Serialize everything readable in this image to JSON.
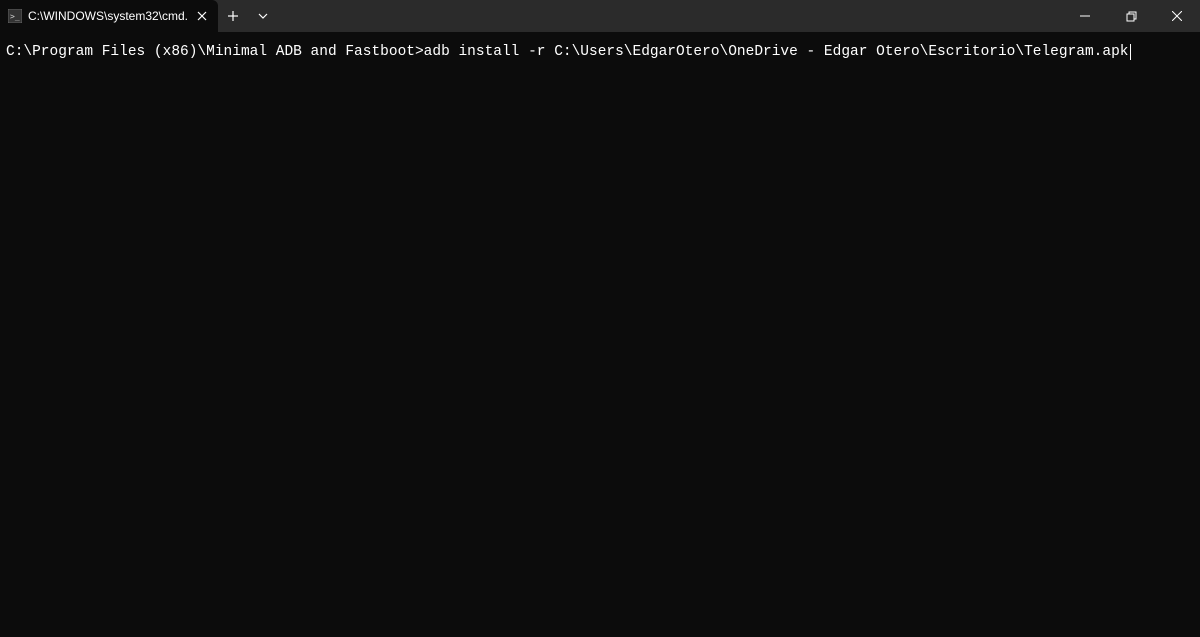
{
  "titlebar": {
    "tab_title": "C:\\WINDOWS\\system32\\cmd.",
    "new_tab_symbol": "+",
    "close_symbol": "✕"
  },
  "terminal": {
    "prompt": "C:\\Program Files (x86)\\Minimal ADB and Fastboot>",
    "command": "adb install -r C:\\Users\\EdgarOtero\\OneDrive - Edgar Otero\\Escritorio\\Telegram.apk"
  }
}
